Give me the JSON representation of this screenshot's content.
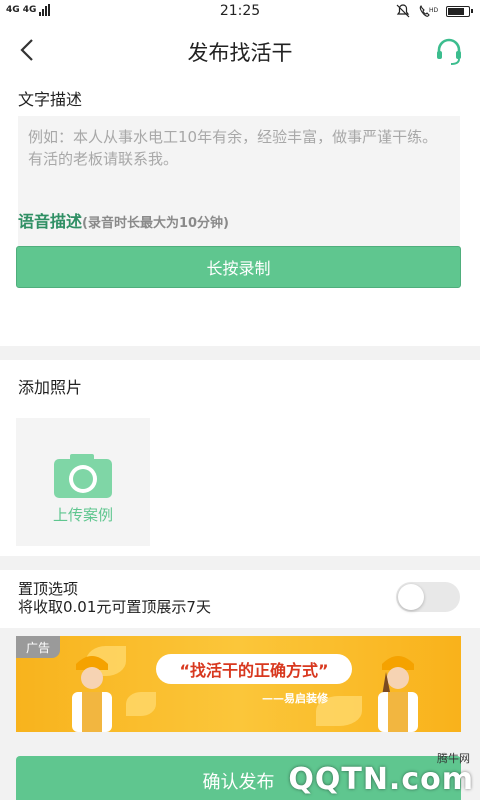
{
  "status_bar": {
    "network": "4G 4G",
    "time": "21:25",
    "icons": [
      "bell-mute-icon",
      "hd-call-icon",
      "battery-icon"
    ]
  },
  "nav": {
    "title": "发布找活干",
    "back_icon": "chevron-left-icon",
    "service_icon": "headset-icon"
  },
  "description": {
    "label": "文字描述",
    "placeholder": "例如：本人从事水电工10年有余，经验丰富，做事严谨干练。有活的老板请联系我。"
  },
  "voice": {
    "label": "语音描述",
    "hint": "(录音时长最大为10分钟)",
    "record_label": "长按录制"
  },
  "photos": {
    "label": "添加照片",
    "upload_label": "上传案例"
  },
  "pin_top": {
    "title": "置顶选项",
    "description": "将收取0.01元可置顶展示7天",
    "enabled": false
  },
  "ad": {
    "tag": "广告",
    "slogan": "“找活干的正确方式”",
    "brand": "——易启装修"
  },
  "confirm_label": "确认发布",
  "watermark": {
    "small": "腾牛网",
    "logo": "QQTN.com"
  },
  "colors": {
    "accent": "#5fc68f",
    "voice_label": "#2f8f64",
    "ad_background": "#f8b31d"
  }
}
